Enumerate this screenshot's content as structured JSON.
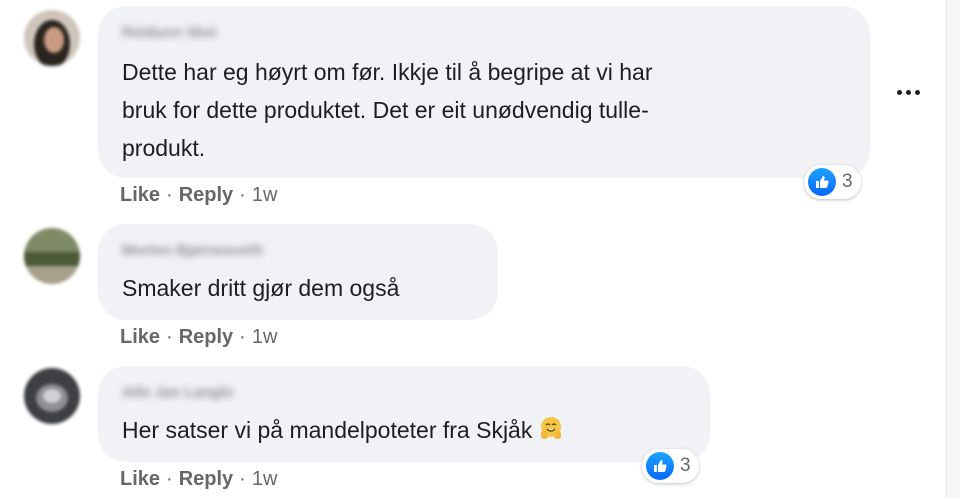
{
  "comments": [
    {
      "author": "Reidunn Skei",
      "lines": [
        "Dette har eg høyrt om før. Ikkje til å begripe at vi har",
        "bruk for dette produktet. Det er eit unødvendig tulle-",
        "produkt."
      ],
      "like_label": "Like",
      "reply_label": "Reply",
      "time": "1w",
      "reaction_count": "3"
    },
    {
      "author": "Morten Bjørnesveth",
      "lines": [
        "Smaker dritt gjør dem også"
      ],
      "like_label": "Like",
      "reply_label": "Reply",
      "time": "1w"
    },
    {
      "author": "Atle Jan Langlo",
      "lines": [
        "Her satser vi på mandelpoteter fra Skjåk"
      ],
      "like_label": "Like",
      "reply_label": "Reply",
      "time": "1w",
      "reaction_count": "3"
    }
  ],
  "separator": "·",
  "icons": {
    "reaction": "thumbs-up-icon",
    "more": "more-options-icon",
    "emoji": "hugging-face-emoji"
  },
  "colors": {
    "bubble": "#f0f2f5",
    "like_blue": "#0866ff",
    "meta_gray": "#65676b"
  }
}
